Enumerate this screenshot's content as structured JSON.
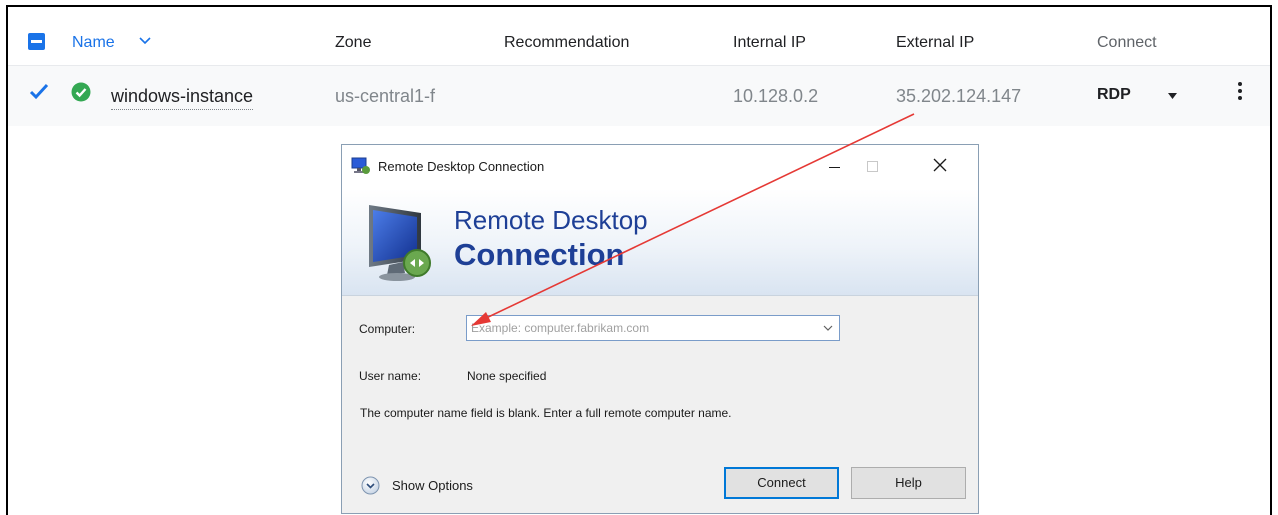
{
  "table": {
    "headers": {
      "name": "Name",
      "zone": "Zone",
      "recommendation": "Recommendation",
      "internal_ip": "Internal IP",
      "external_ip": "External IP",
      "connect": "Connect"
    },
    "row": {
      "name": "windows-instance",
      "zone": "us-central1-f",
      "internal_ip": "10.128.0.2",
      "external_ip": "35.202.124.147",
      "connect": "RDP"
    }
  },
  "dialog": {
    "title": "Remote Desktop Connection",
    "banner_line1": "Remote Desktop",
    "banner_line2": "Connection",
    "computer_label": "Computer:",
    "computer_placeholder": "Example: computer.fabrikam.com",
    "username_label": "User name:",
    "username_value": "None specified",
    "message": "The computer name field is blank. Enter a full remote computer name.",
    "show_options": "Show Options",
    "connect_button": "Connect",
    "help_button": "Help"
  },
  "colors": {
    "link": "#1a73e8",
    "status_ok": "#34a853",
    "annotation_arrow": "#e53935",
    "banner_text": "#1e3f96"
  }
}
